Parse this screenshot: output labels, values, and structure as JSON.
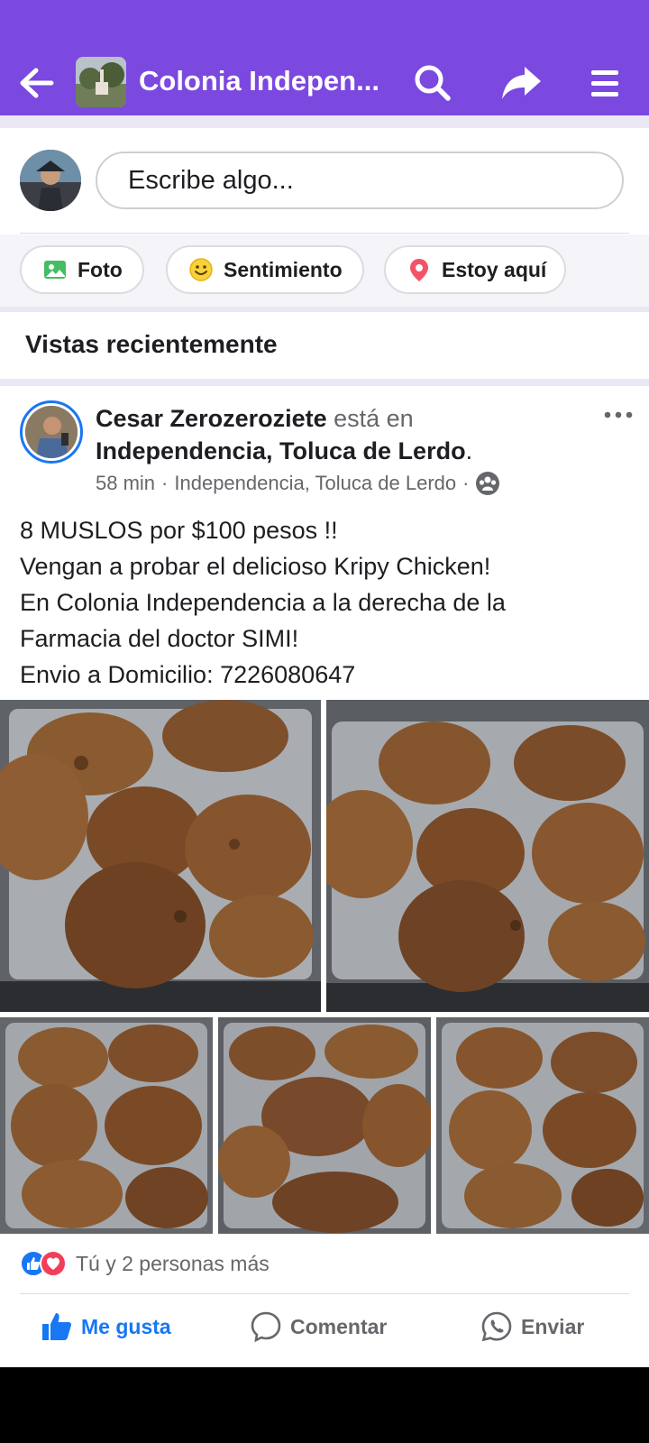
{
  "header": {
    "title": "Colonia Indepen...",
    "bg_color": "#7b48e0"
  },
  "composer": {
    "placeholder": "Escribe algo...",
    "chips": {
      "photo": "Foto",
      "feeling": "Sentimiento",
      "location": "Estoy aquí"
    }
  },
  "recent": {
    "title": "Vistas recientemente"
  },
  "post": {
    "author": "Cesar Zerozeroziete",
    "connector": " está en ",
    "place": "Independencia, Toluca de Lerdo",
    "period": ".",
    "time": "58 min",
    "meta_sep": "·",
    "meta_location": "Independencia, Toluca de Lerdo",
    "lines": [
      "8 MUSLOS por $100 pesos !!",
      "Vengan a probar el delicioso Kripy Chicken!",
      "En Colonia Independencia a la derecha de la",
      "Farmacia del doctor SIMI!",
      "Envio a Domicilio: 7226080647"
    ],
    "reactions_text": "Tú y 2 personas más",
    "actions": {
      "like": "Me gusta",
      "comment": "Comentar",
      "send": "Enviar"
    },
    "like_color": "#1877f2"
  }
}
